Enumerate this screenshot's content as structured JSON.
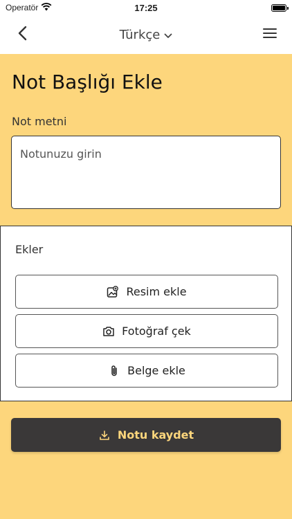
{
  "status_bar": {
    "carrier": "Operatör",
    "time": "17:25"
  },
  "nav": {
    "language": "Türkçe",
    "back_icon": "chevron-left-icon",
    "language_icon": "chevron-down-icon",
    "menu_icon": "hamburger-menu-icon"
  },
  "page": {
    "title": "Not Başlığı Ekle",
    "note_label": "Not metni",
    "note_placeholder": "Notunuzu girin",
    "note_value": ""
  },
  "attachments": {
    "title": "Ekler",
    "buttons": [
      {
        "label": "Resim ekle",
        "icon": "image-add-icon"
      },
      {
        "label": "Fotoğraf çek",
        "icon": "camera-icon"
      },
      {
        "label": "Belge ekle",
        "icon": "paperclip-icon"
      }
    ]
  },
  "save": {
    "label": "Notu kaydet",
    "icon": "download-icon"
  },
  "colors": {
    "background": "#fdd67c",
    "save_button_bg": "#3a3838",
    "save_button_text": "#fdd67c"
  }
}
